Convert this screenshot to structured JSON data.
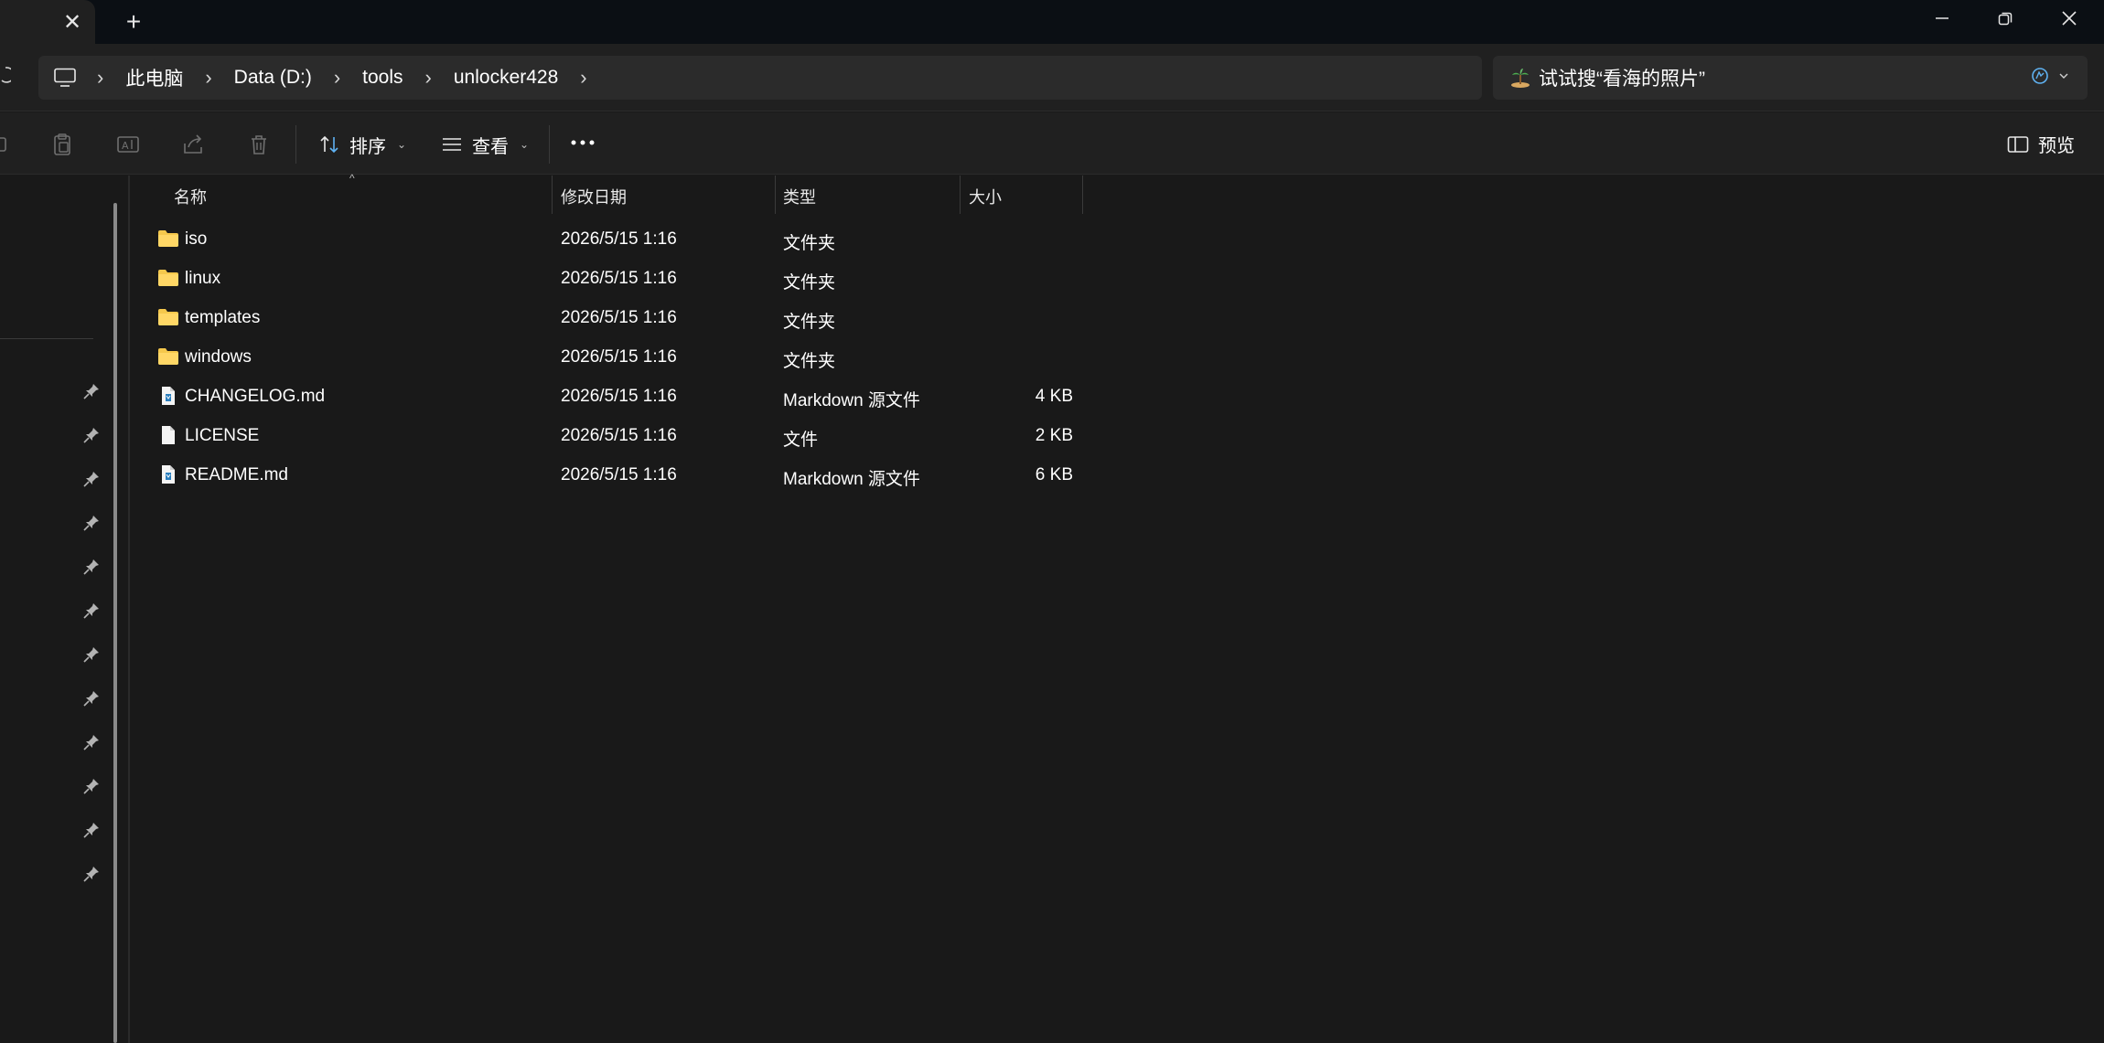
{
  "tabs": {
    "close_glyph": "✕",
    "add_glyph": "+"
  },
  "window_controls": {
    "minimize": "—",
    "maximize": "❐",
    "close": "✕"
  },
  "breadcrumb": {
    "items": [
      "此电脑",
      "Data (D:)",
      "tools",
      "unlocker428"
    ],
    "separator": "›"
  },
  "search": {
    "placeholder": "试试搜“看海的照片”"
  },
  "toolbar": {
    "sort_label": "排序",
    "view_label": "查看",
    "more_label": "•••",
    "preview_label": "预览"
  },
  "columns": {
    "name": "名称",
    "modified": "修改日期",
    "type": "类型",
    "size": "大小"
  },
  "files": [
    {
      "name": "iso",
      "modified": "2026/5/15 1:16",
      "type": "文件夹",
      "size": "",
      "icon": "folder-icon"
    },
    {
      "name": "linux",
      "modified": "2026/5/15 1:16",
      "type": "文件夹",
      "size": "",
      "icon": "folder-icon"
    },
    {
      "name": "templates",
      "modified": "2026/5/15 1:16",
      "type": "文件夹",
      "size": "",
      "icon": "folder-icon"
    },
    {
      "name": "windows",
      "modified": "2026/5/15 1:16",
      "type": "文件夹",
      "size": "",
      "icon": "folder-icon"
    },
    {
      "name": "CHANGELOG.md",
      "modified": "2026/5/15 1:16",
      "type": "Markdown 源文件",
      "size": "4 KB",
      "icon": "markdown-file-icon"
    },
    {
      "name": "LICENSE",
      "modified": "2026/5/15 1:16",
      "type": "文件",
      "size": "2 KB",
      "icon": "file-icon"
    },
    {
      "name": "README.md",
      "modified": "2026/5/15 1:16",
      "type": "Markdown 源文件",
      "size": "6 KB",
      "icon": "markdown-file-icon"
    }
  ],
  "colors": {
    "background": "#191919",
    "titlebar": "#0b0f14",
    "folder": "#f5c84c",
    "accent": "#5fb2f2"
  }
}
